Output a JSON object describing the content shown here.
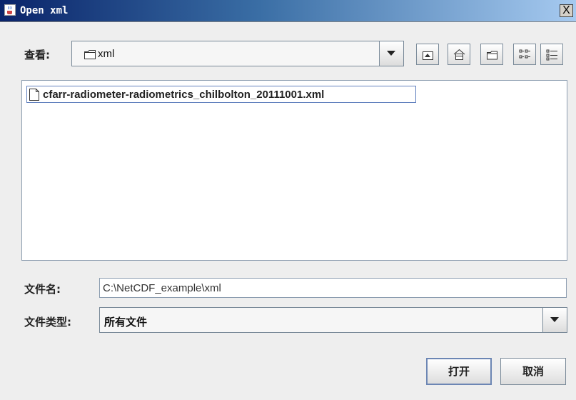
{
  "window": {
    "title": "Open xml",
    "close_label": "X",
    "icon": "java-coffee-icon"
  },
  "look_in": {
    "label": "查看:",
    "value": "xml",
    "icon": "folder-icon"
  },
  "toolbar": {
    "buttons": [
      {
        "name": "up-one-level-icon"
      },
      {
        "name": "home-icon"
      },
      {
        "name": "new-folder-icon"
      },
      {
        "name": "list-view-icon"
      },
      {
        "name": "details-view-icon"
      }
    ]
  },
  "files": [
    {
      "name": "cfarr-radiometer-radiometrics_chilbolton_20111001.xml",
      "icon": "file-icon"
    }
  ],
  "file_name": {
    "label": "文件名:",
    "value": "C:\\NetCDF_example\\xml"
  },
  "file_type": {
    "label": "文件类型:",
    "value": "所有文件"
  },
  "buttons": {
    "open": "打开",
    "cancel": "取消"
  }
}
